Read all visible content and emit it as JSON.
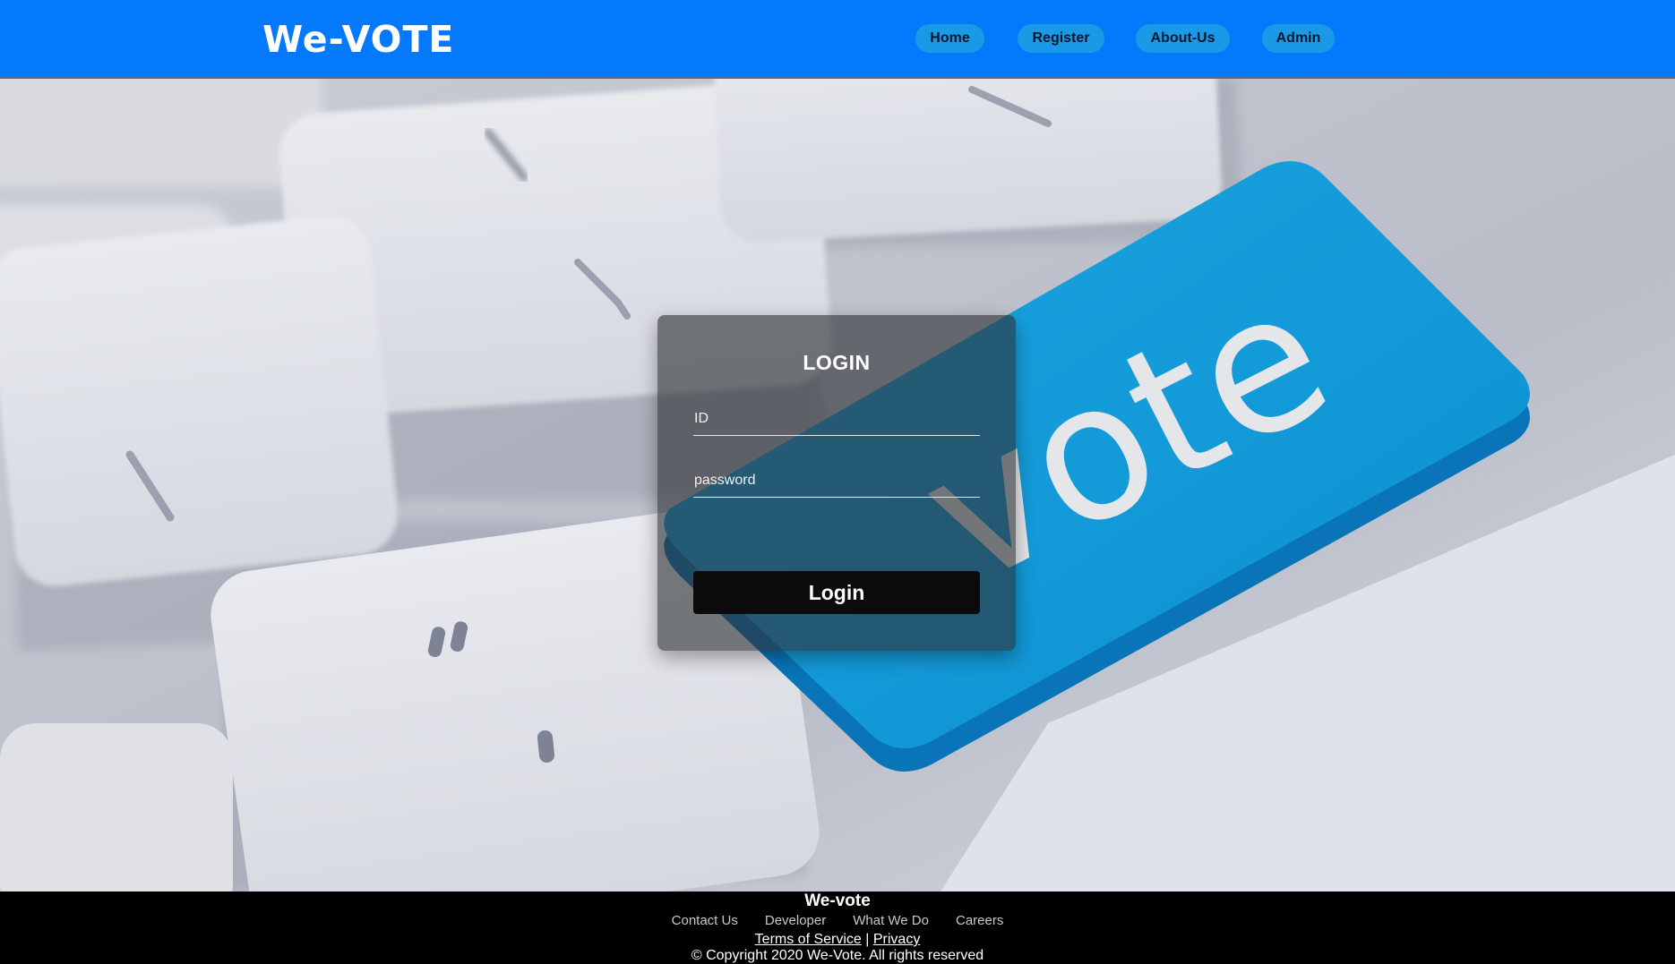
{
  "header": {
    "brand": "We-VOTE",
    "nav": [
      {
        "label": "Home"
      },
      {
        "label": "Register"
      },
      {
        "label": "About-Us"
      },
      {
        "label": "Admin"
      }
    ]
  },
  "hero": {
    "key_text": "vote"
  },
  "login": {
    "title": "LOGIN",
    "id_placeholder": "ID",
    "password_placeholder": "password",
    "button_label": "Login"
  },
  "footer": {
    "title": "We-vote",
    "links": [
      "Contact Us",
      "Developer",
      "What We Do",
      "Careers"
    ],
    "terms": "Terms of Service",
    "separator": "|",
    "privacy": "Privacy",
    "copyright": "© Copyright 2020 We-Vote. All rights reserved"
  },
  "colors": {
    "header_bg": "#0479fb",
    "nav_pill": "#1a9ae6",
    "vote_key": "#0e9ad7",
    "footer_bg": "#000000"
  }
}
